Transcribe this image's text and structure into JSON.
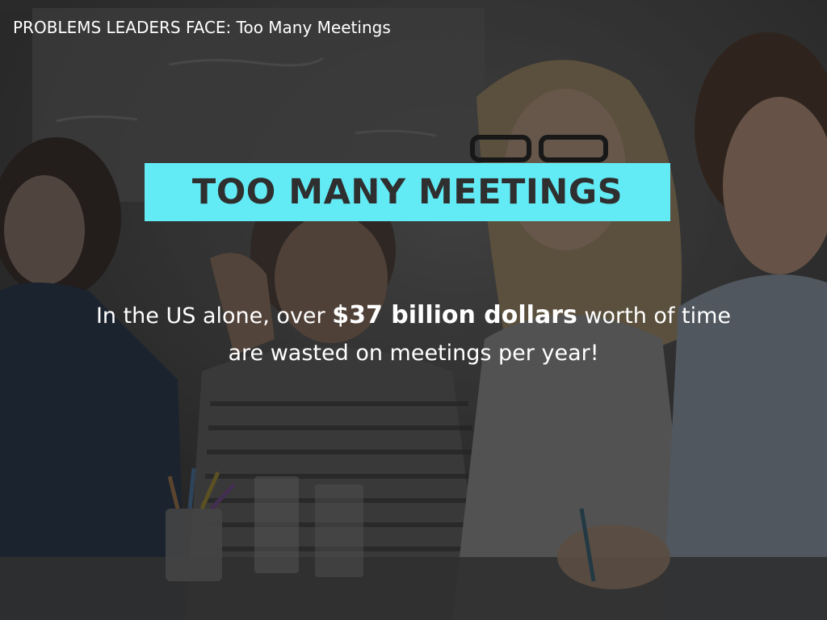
{
  "header": {
    "text": "PROBLEMS LEADERS FACE:  Too Many Meetings"
  },
  "title": {
    "text": "TOO MANY MEETINGS",
    "box_color": "#63ebf5",
    "text_color": "#2f2f2f"
  },
  "statement": {
    "line1_before": "In the US alone, over ",
    "line1_emphasis": "$37 billion dollars",
    "line1_after": " worth of time",
    "line2": "are wasted on meetings per year!"
  },
  "background": {
    "description_icon": "meeting-photo",
    "tone": "#3a3a3a"
  }
}
